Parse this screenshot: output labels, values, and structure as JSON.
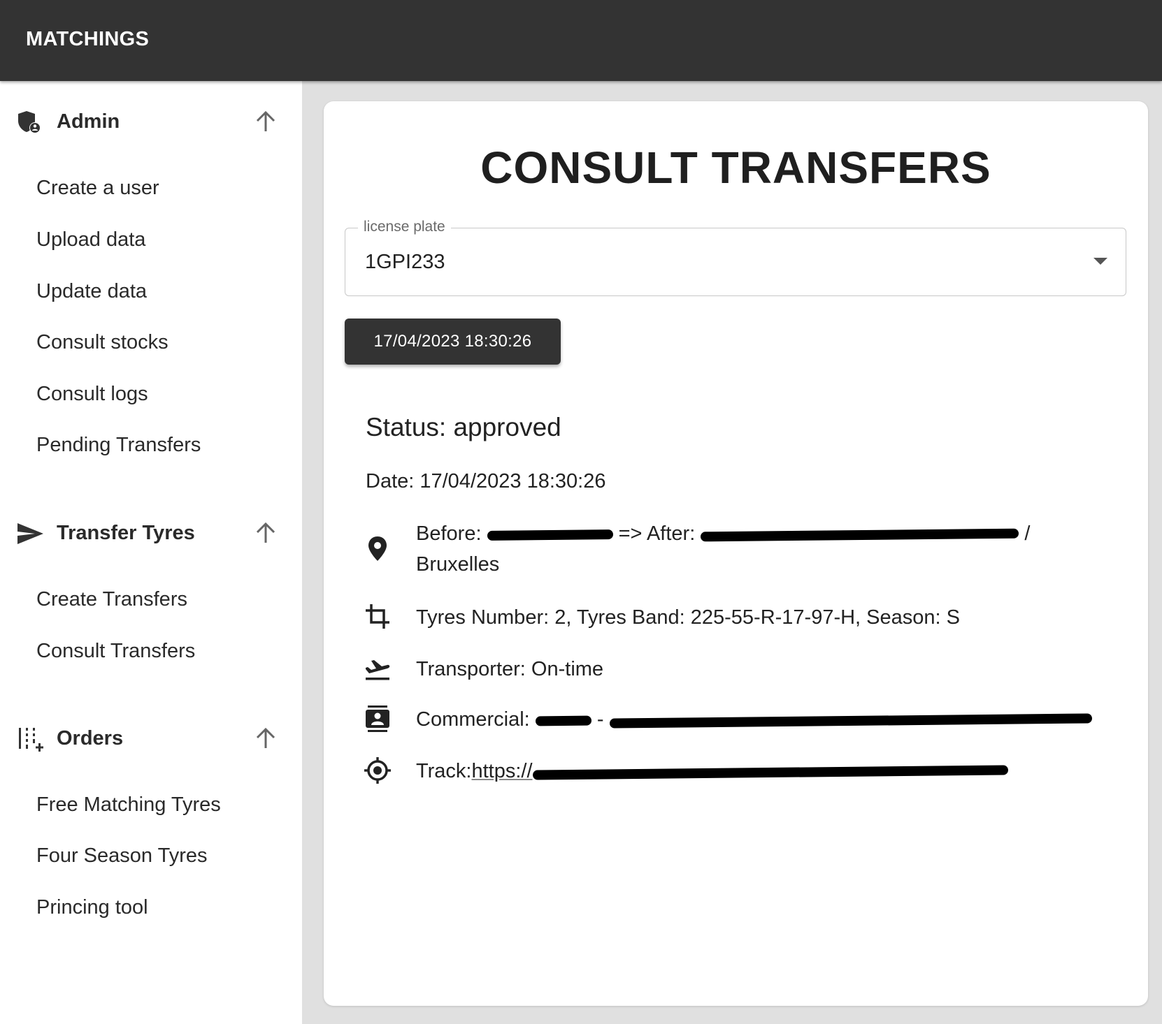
{
  "appbar": {
    "title": "MATCHINGS"
  },
  "sidebar": {
    "sections": [
      {
        "label": "Admin",
        "items": [
          "Create a user",
          "Upload data",
          "Update data",
          "Consult stocks",
          "Consult logs",
          "Pending Transfers"
        ]
      },
      {
        "label": "Transfer Tyres",
        "items": [
          "Create Transfers",
          "Consult Transfers"
        ]
      },
      {
        "label": "Orders",
        "items": [
          "Free Matching Tyres",
          "Four Season Tyres",
          "Princing tool"
        ]
      }
    ]
  },
  "main": {
    "title": "CONSULT TRANSFERS",
    "license_plate": {
      "label": "license plate",
      "value": "1GPI233"
    },
    "date_button": "17/04/2023 18:30:26",
    "status": "Status: approved",
    "date": "Date: 17/04/2023 18:30:26",
    "details": {
      "before_prefix": "Before:",
      "after_prefix": "=> After:",
      "after_suffix": "/",
      "location_line2": "Bruxelles",
      "tyres": "Tyres Number: 2, Tyres Band: 225-55-R-17-97-H, Season: S",
      "transporter": "Transporter: On-time",
      "commercial_prefix": "Commercial:",
      "commercial_mid": "-",
      "track_prefix": "Track:",
      "track_link_visible": "https://"
    }
  },
  "icons": {
    "admin": "shield-user-icon",
    "transfer": "send-icon",
    "orders": "column-add-icon",
    "collapse": "arrow-up-icon",
    "location": "location-pin-icon",
    "tyres": "crop-icon",
    "transporter": "flight-takeoff-icon",
    "commercial": "contact-card-icon",
    "track": "gps-target-icon",
    "dropdown": "caret-down-icon"
  }
}
